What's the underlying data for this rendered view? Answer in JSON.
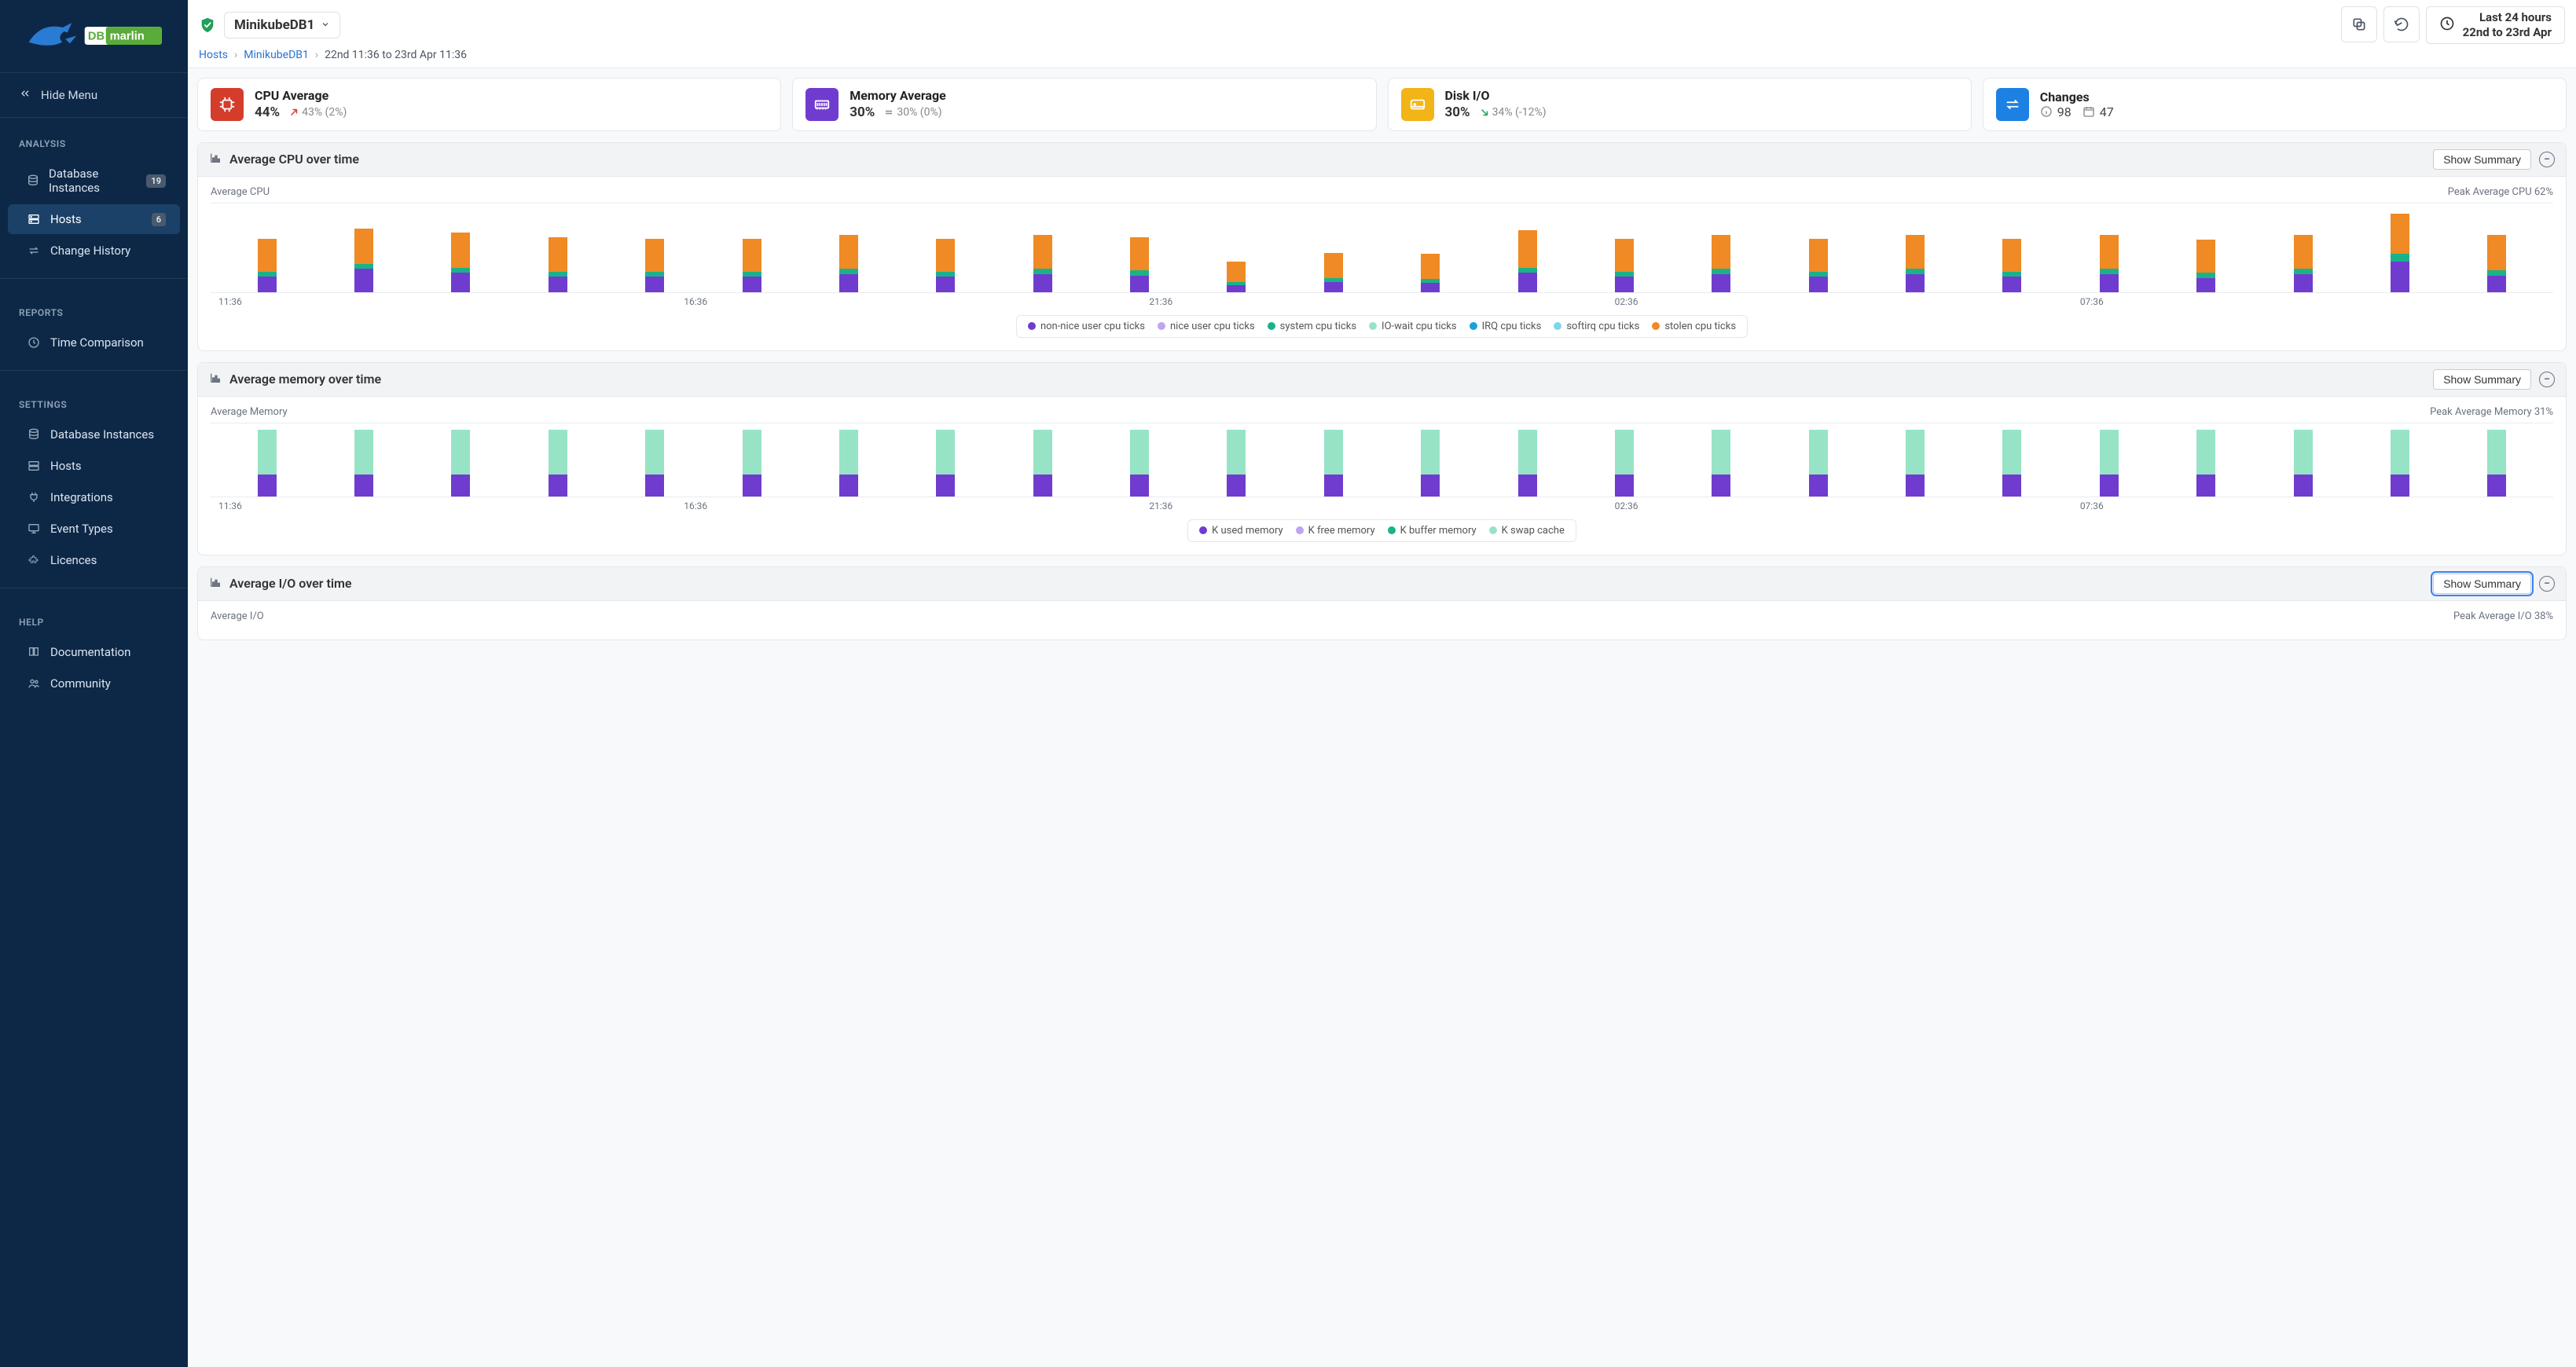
{
  "app": {
    "brand_left": "DB",
    "brand_right": "marlin"
  },
  "sidebar": {
    "hide_label": "Hide Menu",
    "sections": {
      "analysis": {
        "title": "ANALYSIS",
        "items": [
          {
            "label": "Database Instances",
            "badge": "19"
          },
          {
            "label": "Hosts",
            "badge": "6",
            "active": true
          },
          {
            "label": "Change History"
          }
        ]
      },
      "reports": {
        "title": "REPORTS",
        "items": [
          {
            "label": "Time Comparison"
          }
        ]
      },
      "settings": {
        "title": "SETTINGS",
        "items": [
          {
            "label": "Database Instances"
          },
          {
            "label": "Hosts"
          },
          {
            "label": "Integrations"
          },
          {
            "label": "Event Types"
          },
          {
            "label": "Licences"
          }
        ]
      },
      "help": {
        "title": "HELP",
        "items": [
          {
            "label": "Documentation"
          },
          {
            "label": "Community"
          }
        ]
      }
    }
  },
  "header": {
    "host_name": "MinikubeDB1",
    "time": {
      "line1": "Last 24 hours",
      "line2": "22nd to 23rd Apr"
    },
    "breadcrumbs": {
      "root": "Hosts",
      "host": "MinikubeDB1",
      "range": "22nd 11:36 to 23rd Apr 11:36"
    }
  },
  "stats": {
    "cpu": {
      "title": "CPU Average",
      "value": "44%",
      "trend_text": "43% (2%)",
      "trend": "up"
    },
    "memory": {
      "title": "Memory Average",
      "value": "30%",
      "trend_text": "30% (0%)",
      "trend": "eq"
    },
    "disk": {
      "title": "Disk I/O",
      "value": "30%",
      "trend_text": "34% (-12%)",
      "trend": "down"
    },
    "changes": {
      "title": "Changes",
      "info_count": "98",
      "cal_count": "47"
    }
  },
  "panels": {
    "cpu": {
      "title": "Average CPU over time",
      "btn": "Show Summary",
      "sub_left": "Average CPU",
      "sub_right": "Peak Average CPU 62%"
    },
    "mem": {
      "title": "Average memory over time",
      "btn": "Show Summary",
      "sub_left": "Average Memory",
      "sub_right": "Peak Average Memory 31%"
    },
    "io": {
      "title": "Average I/O over time",
      "btn": "Show Summary",
      "sub_left": "Average I/O",
      "sub_right": "Peak Average I/O 38%"
    }
  },
  "legends": {
    "cpu": [
      "non-nice user cpu ticks",
      "nice user cpu ticks",
      "system cpu ticks",
      "IO-wait cpu ticks",
      "IRQ cpu ticks",
      "softirq cpu ticks",
      "stolen cpu ticks"
    ],
    "mem": [
      "K used memory",
      "K free memory",
      "K buffer memory",
      "K swap cache"
    ]
  },
  "xticks": [
    "11:36",
    "16:36",
    "21:36",
    "02:36",
    "07:36"
  ],
  "chart_data": [
    {
      "type": "bar",
      "title": "Average CPU over time",
      "ylabel": "percent",
      "ylim": [
        0,
        62
      ],
      "categories": [
        "11:36",
        "12:36",
        "13:36",
        "14:36",
        "15:36",
        "16:36",
        "17:36",
        "18:36",
        "19:36",
        "20:36",
        "21:36",
        "22:36",
        "23:36",
        "00:36",
        "01:36",
        "02:36",
        "03:36",
        "04:36",
        "05:36",
        "06:36",
        "07:36",
        "08:36",
        "09:36",
        "10:36"
      ],
      "series": [
        {
          "name": "non-nice user cpu ticks",
          "values": [
            12,
            18,
            15,
            12,
            12,
            12,
            14,
            12,
            14,
            13,
            5,
            8,
            7,
            15,
            12,
            14,
            12,
            14,
            12,
            14,
            11,
            14,
            24,
            13,
            12
          ]
        },
        {
          "name": "system cpu ticks",
          "values": [
            4,
            4,
            4,
            4,
            4,
            4,
            4,
            4,
            4,
            4,
            3,
            3,
            3,
            4,
            4,
            4,
            4,
            4,
            4,
            4,
            4,
            4,
            6,
            4,
            4
          ]
        },
        {
          "name": "stolen cpu ticks",
          "values": [
            26,
            28,
            28,
            27,
            26,
            26,
            27,
            26,
            27,
            26,
            16,
            20,
            20,
            30,
            26,
            27,
            26,
            27,
            26,
            27,
            26,
            27,
            32,
            28,
            26
          ]
        }
      ],
      "peak_label": "Peak Average CPU 62%"
    },
    {
      "type": "bar",
      "title": "Average memory over time",
      "ylabel": "percent",
      "ylim": [
        0,
        31
      ],
      "categories": [
        "11:36",
        "12:36",
        "13:36",
        "14:36",
        "15:36",
        "16:36",
        "17:36",
        "18:36",
        "19:36",
        "20:36",
        "21:36",
        "22:36",
        "23:36",
        "00:36",
        "01:36",
        "02:36",
        "03:36",
        "04:36",
        "05:36",
        "06:36",
        "07:36",
        "08:36",
        "09:36",
        "10:36"
      ],
      "series": [
        {
          "name": "K used memory",
          "values": [
            10,
            10,
            10,
            10,
            10,
            10,
            10,
            10,
            10,
            10,
            10,
            10,
            10,
            10,
            10,
            10,
            10,
            10,
            10,
            10,
            10,
            10,
            10,
            10
          ]
        },
        {
          "name": "K buffer memory",
          "values": [
            21,
            21,
            21,
            21,
            21,
            21,
            21,
            21,
            21,
            21,
            21,
            21,
            21,
            21,
            21,
            21,
            21,
            21,
            21,
            21,
            21,
            21,
            21,
            21
          ]
        }
      ],
      "peak_label": "Peak Average Memory 31%"
    }
  ]
}
